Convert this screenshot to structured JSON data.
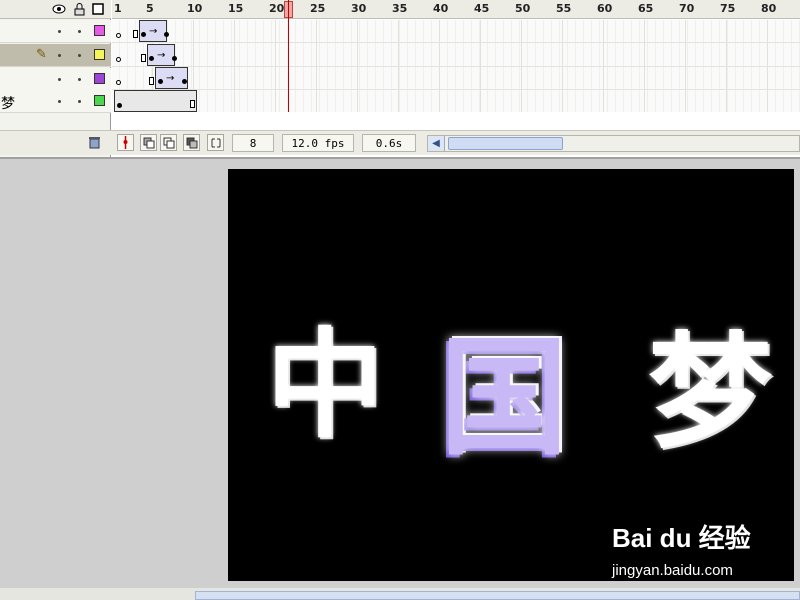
{
  "timeline": {
    "layers": [
      {
        "name": "",
        "color": "#e75ae7",
        "selected": false
      },
      {
        "name": "",
        "color": "#f5f55a",
        "selected": true
      },
      {
        "name": "",
        "color": "#9d45d8",
        "selected": false
      },
      {
        "name": "梦",
        "color": "#4bd64b",
        "selected": false
      }
    ],
    "ruler_ticks": [
      "1",
      "5",
      "10",
      "15",
      "20",
      "25",
      "30",
      "35",
      "40",
      "45",
      "50",
      "55",
      "60",
      "65",
      "70",
      "75",
      "80"
    ],
    "current_frame": "8",
    "frame_rate": "12.0 fps",
    "elapsed_time": "0.6s",
    "icons": {
      "eye": "eye-icon",
      "lock": "lock-icon",
      "outline": "outline-icon",
      "trash": "trash-icon",
      "center_frame": "center-frame-icon",
      "onion_skin": "onion-skin-icon",
      "onion_outlines": "onion-outlines-icon",
      "edit_multiple": "edit-multiple-frames-icon",
      "onion_markers": "onion-markers-icon"
    }
  },
  "stage": {
    "characters": [
      "中",
      "国",
      "梦"
    ],
    "background": "#000000"
  },
  "watermark": {
    "logo": "Bai du 经验",
    "url": "jingyan.baidu.com"
  }
}
